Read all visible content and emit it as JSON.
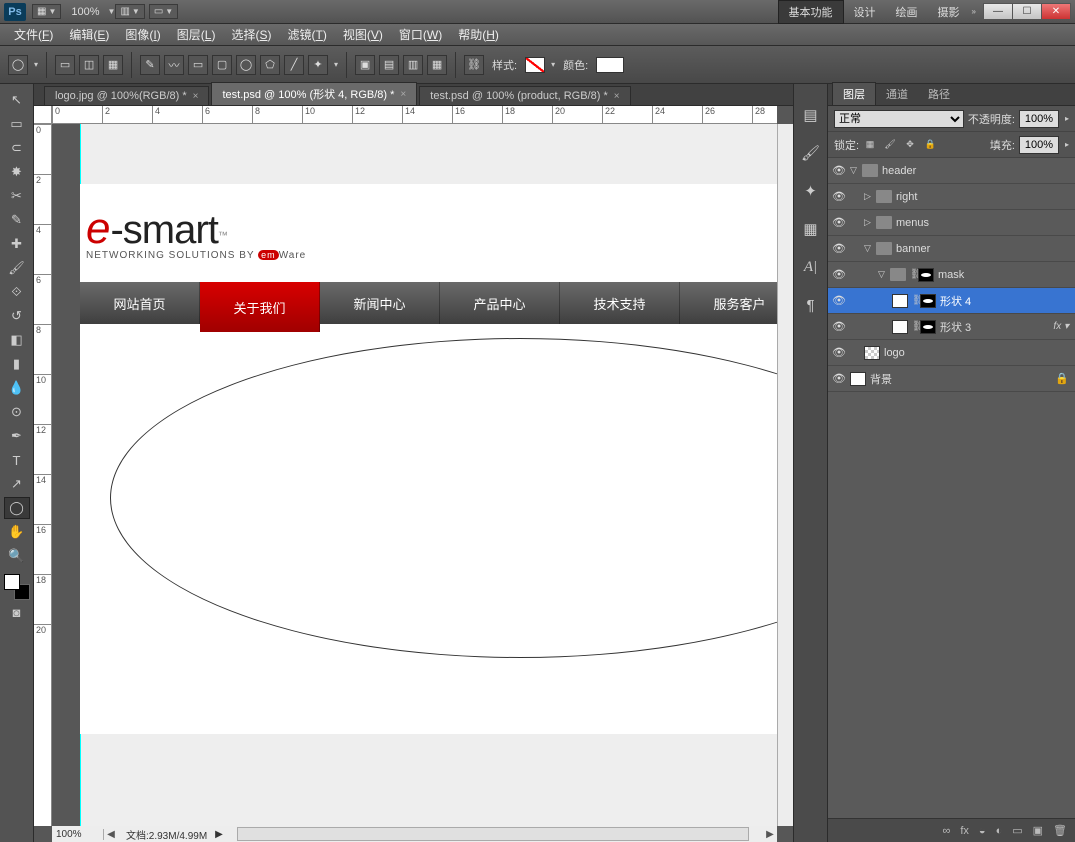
{
  "titlebar": {
    "app_logo": "Ps",
    "zoom_display": "100%",
    "workspaces": [
      "基本功能",
      "设计",
      "绘画",
      "摄影"
    ],
    "active_workspace": 0
  },
  "menubar": [
    {
      "label": "文件",
      "accel": "F"
    },
    {
      "label": "编辑",
      "accel": "E"
    },
    {
      "label": "图像",
      "accel": "I"
    },
    {
      "label": "图层",
      "accel": "L"
    },
    {
      "label": "选择",
      "accel": "S"
    },
    {
      "label": "滤镜",
      "accel": "T"
    },
    {
      "label": "视图",
      "accel": "V"
    },
    {
      "label": "窗口",
      "accel": "W"
    },
    {
      "label": "帮助",
      "accel": "H"
    }
  ],
  "optionsbar": {
    "style_label": "样式:",
    "color_label": "颜色:"
  },
  "tabs": [
    {
      "title": "logo.jpg @ 100%(RGB/8) *",
      "active": false
    },
    {
      "title": "test.psd @ 100% (形状 4, RGB/8) *",
      "active": true
    },
    {
      "title": "test.psd @ 100% (product, RGB/8) *",
      "active": false
    }
  ],
  "ruler_h": [
    "0",
    "2",
    "4",
    "6",
    "8",
    "10",
    "12",
    "14",
    "16",
    "18",
    "20",
    "22",
    "24",
    "26",
    "28"
  ],
  "ruler_v": [
    "0",
    "2",
    "4",
    "6",
    "8",
    "10",
    "12",
    "14",
    "16",
    "18",
    "20"
  ],
  "canvas": {
    "logo_e": "e",
    "logo_rest": "-smart",
    "logo_tm": "™",
    "tagline_pre": "NETWORKING SOLUTIONS BY ",
    "tagline_em": "em",
    "tagline_post": "Ware",
    "nav": [
      "网站首页",
      "关于我们",
      "新闻中心",
      "产品中心",
      "技术支持",
      "服务客户"
    ],
    "nav_active": 1
  },
  "statusbar": {
    "zoom": "100%",
    "doc_label": "文档:",
    "doc_value": "2.93M/4.99M"
  },
  "layers_panel": {
    "tabs": [
      "图层",
      "通道",
      "路径"
    ],
    "active_tab": 0,
    "blend_mode": "正常",
    "opacity_label": "不透明度:",
    "opacity_value": "100%",
    "lock_label": "锁定:",
    "fill_label": "填充:",
    "fill_value": "100%",
    "layers": [
      {
        "depth": 0,
        "type": "group",
        "open": true,
        "name": "header"
      },
      {
        "depth": 1,
        "type": "group",
        "open": false,
        "name": "right"
      },
      {
        "depth": 1,
        "type": "group",
        "open": false,
        "name": "menus"
      },
      {
        "depth": 1,
        "type": "group",
        "open": true,
        "name": "banner"
      },
      {
        "depth": 2,
        "type": "group",
        "open": true,
        "name": "mask",
        "mask": true
      },
      {
        "depth": 3,
        "type": "shape",
        "name": "形状 4",
        "mask": true,
        "selected": true
      },
      {
        "depth": 3,
        "type": "shape",
        "name": "形状 3",
        "mask": true,
        "fx": true
      },
      {
        "depth": 1,
        "type": "layer",
        "name": "logo",
        "trans": true
      },
      {
        "depth": 0,
        "type": "bg",
        "name": "背景",
        "locked": true
      }
    ],
    "footer_icons": [
      "∞",
      "fx",
      "◒",
      "◐",
      "▭",
      "▣",
      "🗑"
    ]
  }
}
